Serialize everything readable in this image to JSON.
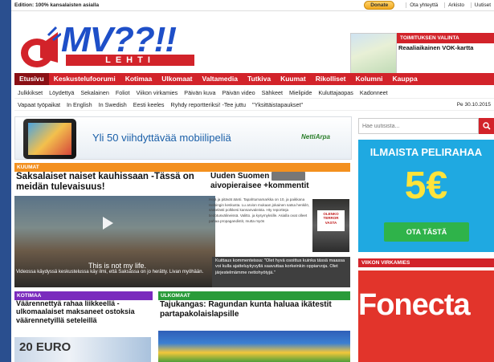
{
  "topbar": {
    "edition": "Edition: 100% kansalaisten asialla",
    "donate": "Donate",
    "links": [
      "Ota yhteyttä",
      "Arkisto",
      "Uutiset"
    ]
  },
  "logo": {
    "main": "MV??!!",
    "sub": "LEHTI"
  },
  "editor_pick": {
    "label": "TOIMITUKSEN VALINTA",
    "title": "Reaaliaikainen VOK-kartta"
  },
  "nav": {
    "items": [
      "Etusivu",
      "Keskustelufoorumi",
      "Kotimaa",
      "Ulkomaat",
      "Valtamedia",
      "Tutkiva",
      "Kuumat",
      "Rikolliset",
      "Kolumni",
      "Kauppa"
    ]
  },
  "subnav": {
    "row1": [
      "Julkkikset",
      "Löydettyä",
      "Sekalainen",
      "Foliot",
      "Viikon virkamies",
      "Päivän kuva",
      "Päivän video",
      "Sähkeet",
      "Mielipide",
      "Kuluttajaopas",
      "Kadonneet"
    ],
    "row2": [
      "Vapaat työpaikat",
      "In English",
      "In Swedish",
      "Eesti keeles",
      "Ryhdy reportteriksi! -Tee juttu",
      "\"Yksittäistapaukset\""
    ],
    "date": "Pe 30.10.2015"
  },
  "banner": {
    "text": "Yli 50 viihdyttävää mobiilipeliä",
    "brand": "NettiArpa"
  },
  "search": {
    "placeholder": "Hae uutisista..."
  },
  "ad_right": {
    "line1": "ILMAISTA PELIRAHAA",
    "amount": "5€",
    "button": "OTA TÄSTÄ"
  },
  "vk": {
    "label": "VIIKON VIRKAMIES",
    "ad": "Fonecta"
  },
  "main_story": {
    "label": "KUUMAT",
    "title": "Saksalaiset naiset kauhissaan -Tässä on meidän tulevaisuus!",
    "overlay": "This is not my life.",
    "caption": "Videossa käydyssä keskustelussa käy ilmi, että Saksassa on jo herätty. Livan myöhään."
  },
  "mid_story": {
    "title": "Uuden Suomen",
    "title2": "aivopieraisee +kommentit",
    "body": "Hejä ja pitävät äänti. Tapahtumamarkka on 10, ja paikkana Helsingin keskusta. Lu arvion mukaan jokainen satsa henkilö, säätelästi polkkesi kansanvaleista. Hty reportteja tiedotusvälineissä. Valitto. ja kysymyksille. Asialla ovat olleet pahaa propagandistit, mutta myös",
    "sign": "OLENKO TERROR VASTA",
    "comment": "Kuittaus kommenteissa: \"Olet hyvä osoittus kuinka tässä maassa voi kulla ajatteluykyvyllä saavuttaa korkeinkin oppiarvoja. Olet järjestelmämme nettohyötyjä.\""
  },
  "bottom_left": {
    "label": "KOTIMAA",
    "title": "Väärennettyä rahaa liikkeellä - ulkomaalaiset maksaneet ostoksia väärennetyillä seteleillä",
    "img_text": "20 EURO"
  },
  "bottom_right": {
    "label": "ULKOMAAT",
    "title": "Tajukangas: Ragundan kunta haluaa ikätestit partapakolaislapsille"
  }
}
